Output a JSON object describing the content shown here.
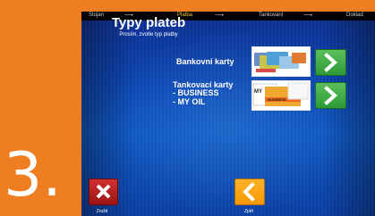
{
  "step_number": "3.",
  "steps": [
    "Stojan",
    "Platba",
    "Tankování",
    "Doklad"
  ],
  "active_step": "Platba",
  "title": "Typy plateb",
  "subtitle": "Prosím, zvolte typ platby",
  "options": [
    {
      "label": "Bankovní karty"
    },
    {
      "label": "Tankovací karty",
      "lines": [
        "- BUSINESS",
        "- MY OIL"
      ]
    }
  ],
  "card_texts": {
    "business": "BUSINESS",
    "myoil": "MY"
  },
  "buttons": {
    "cancel": "Zrušit",
    "back": "Zpět"
  },
  "colors": {
    "accent": "#ef7d22",
    "next": "#3aa63f",
    "cancel": "#c0201f",
    "back": "#f7a21b"
  },
  "icons": {
    "next": "chevron-right-icon",
    "cancel": "close-icon",
    "back": "chevron-left-icon"
  }
}
